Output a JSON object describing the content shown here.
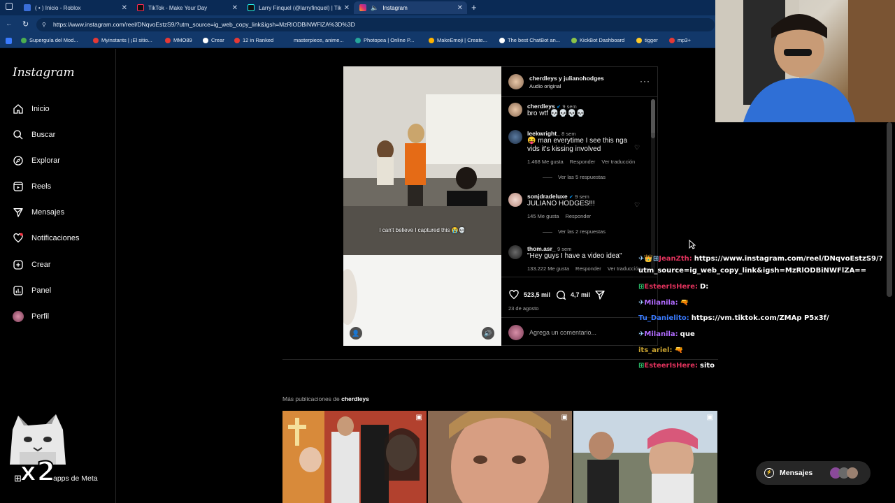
{
  "browser": {
    "tabs": [
      {
        "label": "( • ) Inicio - Roblox"
      },
      {
        "label": "TikTok - Make Your Day"
      },
      {
        "label": "Larry Finquel (@larryfinquel) | Tik"
      },
      {
        "label": "Instagram"
      }
    ],
    "url": "https://www.instagram.com/reel/DNqvoEstzS9/?utm_source=ig_web_copy_link&igsh=MzRlODBiNWFlZA%3D%3D",
    "bookmarks": [
      "Superguía del Mod...",
      "Myinstants | ¡El sitio...",
      "MMO89",
      "Crear",
      "12 in Ranked",
      "masterpiece, anime...",
      "Photopea | Online P...",
      "MakeEmoji | Create...",
      "The best ChatBot an...",
      "KickBot Dashboard",
      "tigger",
      "mp3+"
    ]
  },
  "sidebar": {
    "logo": "Instagram",
    "items": [
      {
        "label": "Inicio",
        "icon": "home-icon"
      },
      {
        "label": "Buscar",
        "icon": "search-icon"
      },
      {
        "label": "Explorar",
        "icon": "compass-icon"
      },
      {
        "label": "Reels",
        "icon": "reels-icon"
      },
      {
        "label": "Mensajes",
        "icon": "send-icon"
      },
      {
        "label": "Notificaciones",
        "icon": "heart-icon"
      },
      {
        "label": "Crear",
        "icon": "plus-icon"
      },
      {
        "label": "Panel",
        "icon": "chart-icon"
      },
      {
        "label": "Perfil",
        "icon": "avatar-icon"
      }
    ],
    "footer": "apps de Meta"
  },
  "post": {
    "header_users": "cherdleys y julianohodges",
    "header_sub": "Audio original",
    "caption_overlay": "I can't believe I captured this 😭💀",
    "comments": [
      {
        "user": "cherdleys",
        "time": "9 sem",
        "text": "bro wtf 💀💀💀💀",
        "likes": "",
        "reply": "",
        "translate": "",
        "replies": ""
      },
      {
        "user": "leekwright_",
        "time": "8 sem",
        "text": "😝 man everytime I see this nga vids it's kissing involved",
        "likes": "1.468 Me gusta",
        "reply": "Responder",
        "translate": "Ver traducción",
        "replies": "Ver las 5 respuestas"
      },
      {
        "user": "sonjdradeluxe",
        "time": "9 sem",
        "text": "JULIANO HODGES!!!",
        "likes": "145 Me gusta",
        "reply": "Responder",
        "translate": "",
        "replies": "Ver las 2 respuestas"
      },
      {
        "user": "thom.asr_",
        "time": "9 sem",
        "text": "\"Hey guys I have a video idea\"",
        "likes": "133.222 Me gusta",
        "reply": "Responder",
        "translate": "Ver traducción",
        "replies": ""
      }
    ],
    "like_count": "523,5 mil",
    "comment_count": "4,7 mil",
    "date": "23 de agosto",
    "comment_placeholder": "Agrega un comentario..."
  },
  "chat": [
    {
      "name": "JeanZth:",
      "msg": "https://www.instagram.com/reel/DNqvoEstzS9/?",
      "color": "#e0325c"
    },
    {
      "name": "",
      "msg": "utm_source=ig_web_copy_link&igsh=MzRlODBiNWFlZA==",
      "color": "#ffffff"
    },
    {
      "name": "EsteerIsHere:",
      "msg": "D:",
      "color": "#e0325c"
    },
    {
      "name": "Milanila:",
      "msg": "🔫",
      "color": "#b16bff"
    },
    {
      "name": "Tu_Danielito:",
      "msg": "https://vm.tiktok.com/ZMAp P5x3f/",
      "color": "#3a7bff"
    },
    {
      "name": "Milanila:",
      "msg": "que",
      "color": "#b16bff"
    },
    {
      "name": "its_ariel:",
      "msg": "🔫",
      "color": "#c7a12f"
    },
    {
      "name": "EsteerIsHere:",
      "msg": "sito",
      "color": "#e0325c"
    }
  ],
  "more_posts": {
    "prefix": "Más publicaciones de",
    "user": "cherdleys"
  },
  "overlay_badge": "x2",
  "messages_button": "Mensajes"
}
